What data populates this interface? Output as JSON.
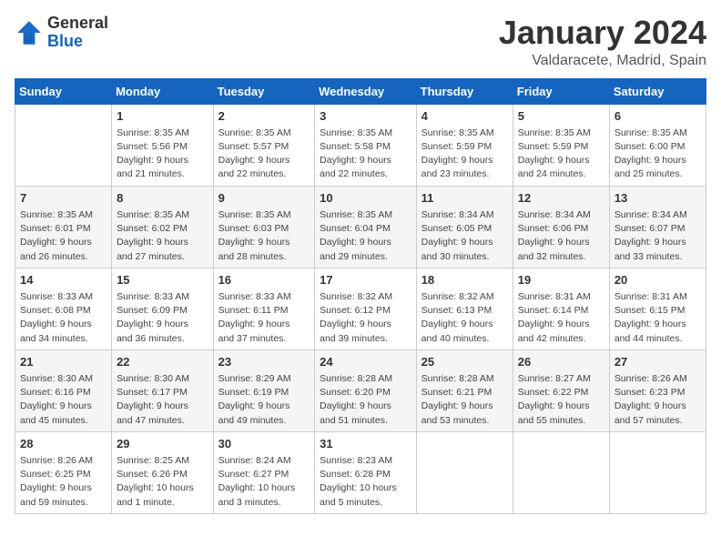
{
  "header": {
    "logo_general": "General",
    "logo_blue": "Blue",
    "main_title": "January 2024",
    "subtitle": "Valdaracete, Madrid, Spain"
  },
  "calendar": {
    "days_of_week": [
      "Sunday",
      "Monday",
      "Tuesday",
      "Wednesday",
      "Thursday",
      "Friday",
      "Saturday"
    ],
    "weeks": [
      [
        {
          "day": "",
          "info": ""
        },
        {
          "day": "1",
          "info": "Sunrise: 8:35 AM\nSunset: 5:56 PM\nDaylight: 9 hours\nand 21 minutes."
        },
        {
          "day": "2",
          "info": "Sunrise: 8:35 AM\nSunset: 5:57 PM\nDaylight: 9 hours\nand 22 minutes."
        },
        {
          "day": "3",
          "info": "Sunrise: 8:35 AM\nSunset: 5:58 PM\nDaylight: 9 hours\nand 22 minutes."
        },
        {
          "day": "4",
          "info": "Sunrise: 8:35 AM\nSunset: 5:59 PM\nDaylight: 9 hours\nand 23 minutes."
        },
        {
          "day": "5",
          "info": "Sunrise: 8:35 AM\nSunset: 5:59 PM\nDaylight: 9 hours\nand 24 minutes."
        },
        {
          "day": "6",
          "info": "Sunrise: 8:35 AM\nSunset: 6:00 PM\nDaylight: 9 hours\nand 25 minutes."
        }
      ],
      [
        {
          "day": "7",
          "info": "Sunrise: 8:35 AM\nSunset: 6:01 PM\nDaylight: 9 hours\nand 26 minutes."
        },
        {
          "day": "8",
          "info": "Sunrise: 8:35 AM\nSunset: 6:02 PM\nDaylight: 9 hours\nand 27 minutes."
        },
        {
          "day": "9",
          "info": "Sunrise: 8:35 AM\nSunset: 6:03 PM\nDaylight: 9 hours\nand 28 minutes."
        },
        {
          "day": "10",
          "info": "Sunrise: 8:35 AM\nSunset: 6:04 PM\nDaylight: 9 hours\nand 29 minutes."
        },
        {
          "day": "11",
          "info": "Sunrise: 8:34 AM\nSunset: 6:05 PM\nDaylight: 9 hours\nand 30 minutes."
        },
        {
          "day": "12",
          "info": "Sunrise: 8:34 AM\nSunset: 6:06 PM\nDaylight: 9 hours\nand 32 minutes."
        },
        {
          "day": "13",
          "info": "Sunrise: 8:34 AM\nSunset: 6:07 PM\nDaylight: 9 hours\nand 33 minutes."
        }
      ],
      [
        {
          "day": "14",
          "info": "Sunrise: 8:33 AM\nSunset: 6:08 PM\nDaylight: 9 hours\nand 34 minutes."
        },
        {
          "day": "15",
          "info": "Sunrise: 8:33 AM\nSunset: 6:09 PM\nDaylight: 9 hours\nand 36 minutes."
        },
        {
          "day": "16",
          "info": "Sunrise: 8:33 AM\nSunset: 6:11 PM\nDaylight: 9 hours\nand 37 minutes."
        },
        {
          "day": "17",
          "info": "Sunrise: 8:32 AM\nSunset: 6:12 PM\nDaylight: 9 hours\nand 39 minutes."
        },
        {
          "day": "18",
          "info": "Sunrise: 8:32 AM\nSunset: 6:13 PM\nDaylight: 9 hours\nand 40 minutes."
        },
        {
          "day": "19",
          "info": "Sunrise: 8:31 AM\nSunset: 6:14 PM\nDaylight: 9 hours\nand 42 minutes."
        },
        {
          "day": "20",
          "info": "Sunrise: 8:31 AM\nSunset: 6:15 PM\nDaylight: 9 hours\nand 44 minutes."
        }
      ],
      [
        {
          "day": "21",
          "info": "Sunrise: 8:30 AM\nSunset: 6:16 PM\nDaylight: 9 hours\nand 45 minutes."
        },
        {
          "day": "22",
          "info": "Sunrise: 8:30 AM\nSunset: 6:17 PM\nDaylight: 9 hours\nand 47 minutes."
        },
        {
          "day": "23",
          "info": "Sunrise: 8:29 AM\nSunset: 6:19 PM\nDaylight: 9 hours\nand 49 minutes."
        },
        {
          "day": "24",
          "info": "Sunrise: 8:28 AM\nSunset: 6:20 PM\nDaylight: 9 hours\nand 51 minutes."
        },
        {
          "day": "25",
          "info": "Sunrise: 8:28 AM\nSunset: 6:21 PM\nDaylight: 9 hours\nand 53 minutes."
        },
        {
          "day": "26",
          "info": "Sunrise: 8:27 AM\nSunset: 6:22 PM\nDaylight: 9 hours\nand 55 minutes."
        },
        {
          "day": "27",
          "info": "Sunrise: 8:26 AM\nSunset: 6:23 PM\nDaylight: 9 hours\nand 57 minutes."
        }
      ],
      [
        {
          "day": "28",
          "info": "Sunrise: 8:26 AM\nSunset: 6:25 PM\nDaylight: 9 hours\nand 59 minutes."
        },
        {
          "day": "29",
          "info": "Sunrise: 8:25 AM\nSunset: 6:26 PM\nDaylight: 10 hours\nand 1 minute."
        },
        {
          "day": "30",
          "info": "Sunrise: 8:24 AM\nSunset: 6:27 PM\nDaylight: 10 hours\nand 3 minutes."
        },
        {
          "day": "31",
          "info": "Sunrise: 8:23 AM\nSunset: 6:28 PM\nDaylight: 10 hours\nand 5 minutes."
        },
        {
          "day": "",
          "info": ""
        },
        {
          "day": "",
          "info": ""
        },
        {
          "day": "",
          "info": ""
        }
      ]
    ]
  }
}
